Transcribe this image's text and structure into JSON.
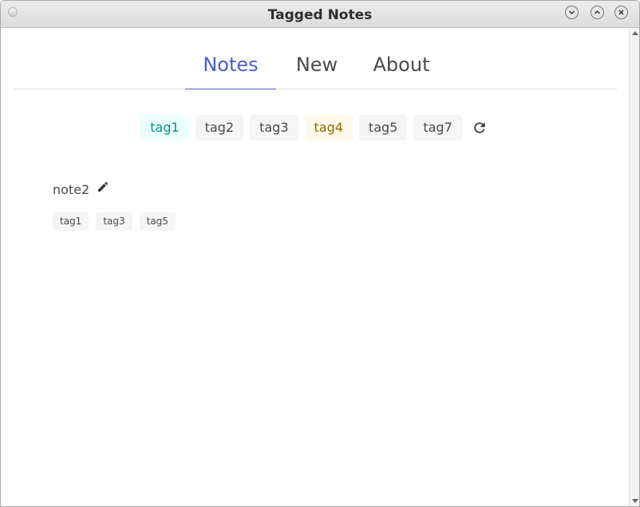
{
  "window": {
    "title": "Tagged Notes"
  },
  "tabs": [
    {
      "label": "Notes",
      "active": true
    },
    {
      "label": "New",
      "active": false
    },
    {
      "label": "About",
      "active": false
    }
  ],
  "tag_filter": {
    "tags": [
      {
        "label": "tag1",
        "state": "selected",
        "color": "#00947e"
      },
      {
        "label": "tag2",
        "state": "normal"
      },
      {
        "label": "tag3",
        "state": "normal"
      },
      {
        "label": "tag4",
        "state": "selected",
        "color": "#946c00"
      },
      {
        "label": "tag5",
        "state": "normal"
      },
      {
        "label": "tag7",
        "state": "normal"
      }
    ],
    "refresh_icon": "refresh-icon"
  },
  "notes": [
    {
      "title": "note2",
      "edit_icon": "pencil-icon",
      "tags": [
        "tag1",
        "tag3",
        "tag5"
      ]
    }
  ],
  "colors": {
    "accent": "#485fc7",
    "tag_background": "#f5f5f5"
  }
}
